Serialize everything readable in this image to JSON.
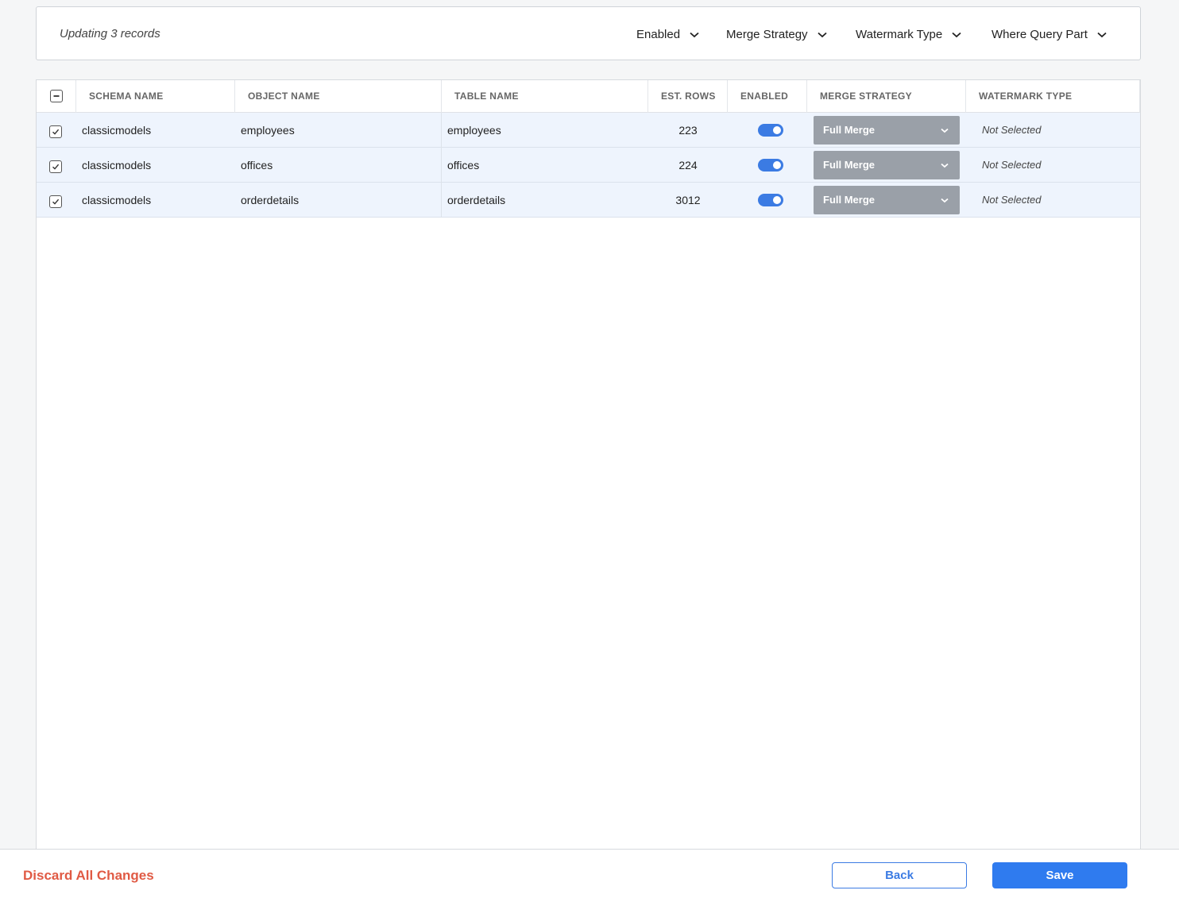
{
  "bulk_bar": {
    "title": "Updating 3 records",
    "filters": [
      "Enabled",
      "Merge Strategy",
      "Watermark Type",
      "Where Query Part"
    ]
  },
  "table": {
    "headers": {
      "schema": "SCHEMA NAME",
      "object": "OBJECT NAME",
      "table": "TABLE NAME",
      "rows": "EST. ROWS",
      "enabled": "ENABLED",
      "merge": "MERGE STRATEGY",
      "watermark": "WATERMARK TYPE"
    },
    "rows": [
      {
        "schema": "classicmodels",
        "object": "employees",
        "table": "employees",
        "est_rows": "223",
        "enabled": true,
        "merge": "Full Merge",
        "watermark": "Not Selected",
        "checked": true
      },
      {
        "schema": "classicmodels",
        "object": "offices",
        "table": "offices",
        "est_rows": "224",
        "enabled": true,
        "merge": "Full Merge",
        "watermark": "Not Selected",
        "checked": true
      },
      {
        "schema": "classicmodels",
        "object": "orderdetails",
        "table": "orderdetails",
        "est_rows": "3012",
        "enabled": true,
        "merge": "Full Merge",
        "watermark": "Not Selected",
        "checked": true
      }
    ]
  },
  "footer": {
    "discard": "Discard All Changes",
    "back": "Back",
    "save": "Save"
  },
  "colors": {
    "accent": "#2f7bef",
    "danger": "#e05a44",
    "row_selected": "#eef4fd"
  }
}
